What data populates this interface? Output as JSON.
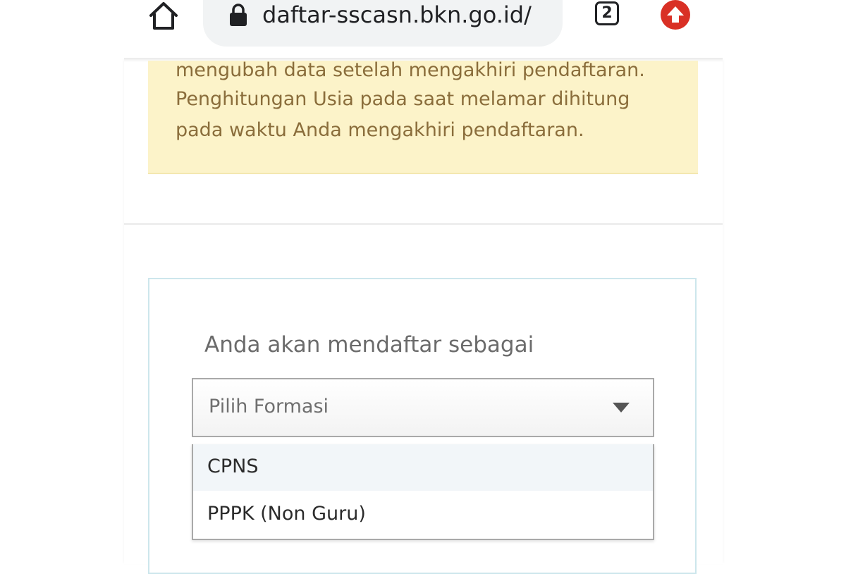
{
  "browser": {
    "url": "daftar-sscasn.bkn.go.id/",
    "tab_count": "2",
    "icons": {
      "home": "home-icon",
      "lock": "lock-icon",
      "tabs": "tab-switcher-icon",
      "update": "update-arrow-icon"
    },
    "update_color": "#d93025"
  },
  "notice": {
    "lines": [
      "mengubah data setelah mengakhiri pendaftaran.",
      "Penghitungan Usia pada saat melamar dihitung",
      "pada waktu Anda mengakhiri pendaftaran."
    ],
    "background_color": "#fcf3c9",
    "text_color": "#8a6d3b"
  },
  "form": {
    "label": "Anda akan mendaftar sebagai",
    "select": {
      "value": "Pilih Formasi",
      "options": [
        {
          "label": "CPNS",
          "highlighted": true
        },
        {
          "label": "PPPK (Non Guru)",
          "highlighted": false
        }
      ]
    }
  }
}
